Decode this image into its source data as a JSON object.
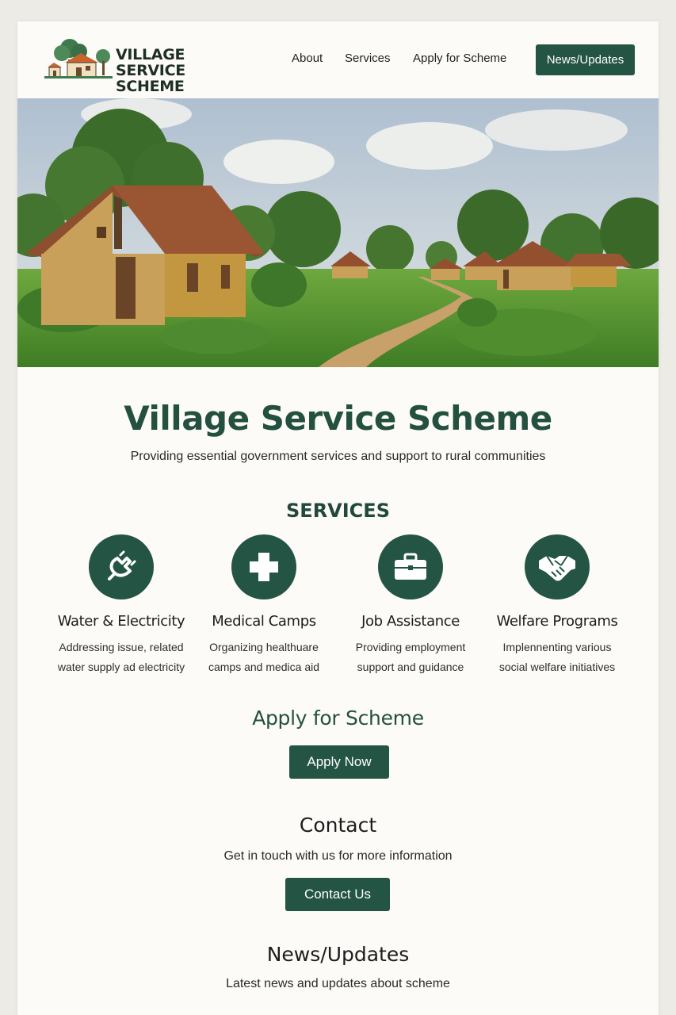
{
  "header": {
    "logo_line1": "VILLAGE",
    "logo_line2": "SERVICE SCHEME",
    "nav": [
      "About",
      "Services",
      "Apply for Scheme"
    ],
    "news_button": "News/Updates"
  },
  "hero": {
    "title": "Village Service Scheme",
    "subtitle": "Providing essential government services and support to rural communities"
  },
  "services": {
    "heading": "SERVICES",
    "items": [
      {
        "icon": "plug-icon",
        "name": "Water & Electricity",
        "desc1": "Addressing issue, related",
        "desc2": "water supply ad electricity"
      },
      {
        "icon": "medical-cross-icon",
        "name": "Medical Camps",
        "desc1": "Organizing healthuare",
        "desc2": "camps and medica aid"
      },
      {
        "icon": "briefcase-icon",
        "name": "Job Assistance",
        "desc1": "Providing employment",
        "desc2": "support and guidance"
      },
      {
        "icon": "handshake-icon",
        "name": "Welfare Programs",
        "desc1": "Implennenting various",
        "desc2": "social welfare initiatives"
      }
    ]
  },
  "apply": {
    "heading": "Apply for Scheme",
    "button": "Apply Now"
  },
  "contact": {
    "heading": "Contact",
    "text": "Get in touch with us for more information",
    "button": "Contact Us"
  },
  "news": {
    "heading": "News/Updates",
    "text": "Latest news and updates about scheme"
  },
  "colors": {
    "primary": "#245444",
    "title": "#24503f",
    "background": "#fcfbf8"
  }
}
